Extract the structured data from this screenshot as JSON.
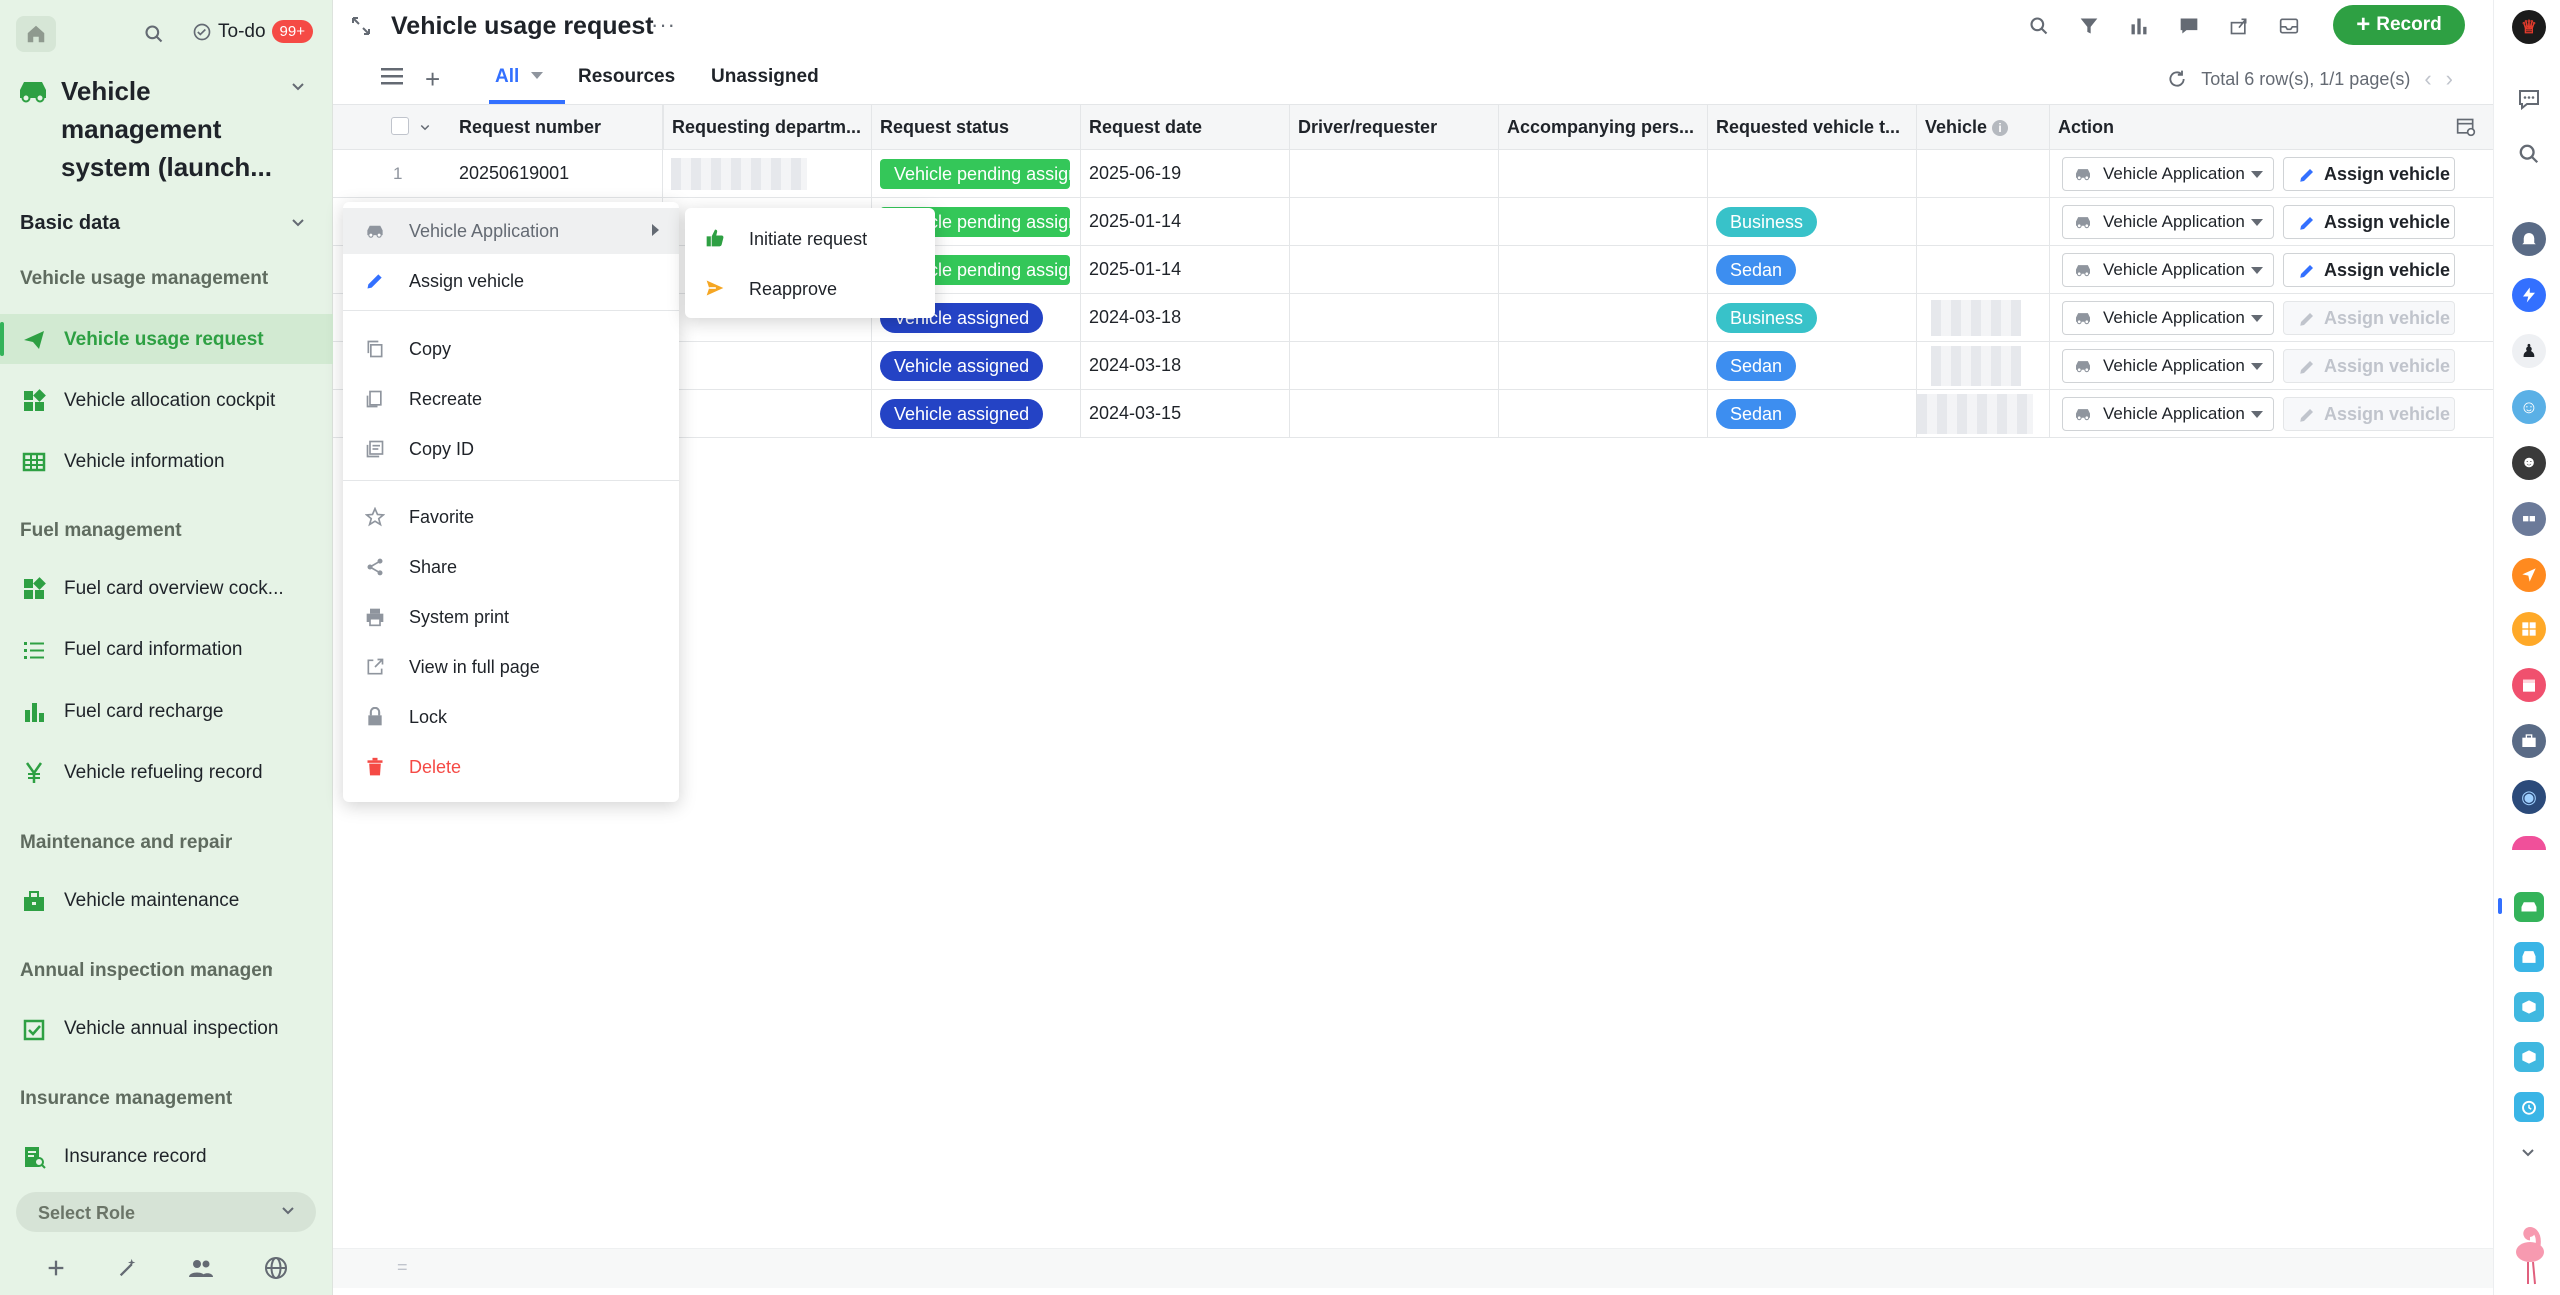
{
  "sidebar": {
    "todo_label": "To-do",
    "todo_badge": "99+",
    "app_title": "Vehicle management system (launch...",
    "basic_data": "Basic data",
    "sections": {
      "vehicle_usage": "Vehicle usage management",
      "fuel": "Fuel management",
      "maintenance": "Maintenance and repair",
      "annual": "Annual inspection management",
      "insurance": "Insurance management"
    },
    "items": {
      "vehicle_usage_request": "Vehicle usage request",
      "allocation_cockpit": "Vehicle allocation cockpit",
      "vehicle_information": "Vehicle information",
      "fuel_overview": "Fuel card overview cock...",
      "fuel_info": "Fuel card information",
      "fuel_recharge": "Fuel card recharge",
      "refueling_record": "Vehicle refueling record",
      "maintenance": "Vehicle maintenance",
      "annual_inspection": "Vehicle annual inspection",
      "insurance_record": "Insurance record"
    },
    "select_role": "Select Role"
  },
  "header": {
    "title": "Vehicle usage request",
    "record_button": "Record"
  },
  "tabs": {
    "all": "All",
    "resources": "Resources",
    "unassigned": "Unassigned"
  },
  "paging": "Total 6 row(s), 1/1 page(s)",
  "table": {
    "columns": [
      "Request number",
      "Requesting departm...",
      "Request status",
      "Request date",
      "Driver/requester",
      "Accompanying pers...",
      "Requested vehicle t...",
      "Vehicle",
      "Action"
    ],
    "rows": [
      {
        "num": "1",
        "request_number": "20250619001",
        "status": "Vehicle pending assignment",
        "date": "2025-06-19",
        "vehicle_type": "",
        "action": "Vehicle Application",
        "assign": "Assign vehicle"
      },
      {
        "num": "",
        "request_number": "",
        "status": "Vehicle pending assignment",
        "date": "2025-01-14",
        "vehicle_type": "Business",
        "action": "Vehicle Application",
        "assign": "Assign vehicle"
      },
      {
        "num": "",
        "request_number": "",
        "status": "Vehicle pending assignment",
        "date": "2025-01-14",
        "vehicle_type": "Sedan",
        "action": "Vehicle Application",
        "assign": "Assign vehicle"
      },
      {
        "num": "",
        "request_number": "",
        "status": "Vehicle assigned",
        "date": "2024-03-18",
        "vehicle_type": "Business",
        "action": "Vehicle Application",
        "assign": "Assign vehicle"
      },
      {
        "num": "",
        "request_number": "",
        "status": "Vehicle assigned",
        "date": "2024-03-18",
        "vehicle_type": "Sedan",
        "action": "Vehicle Application",
        "assign": "Assign vehicle"
      },
      {
        "num": "",
        "request_number": "",
        "status": "Vehicle assigned",
        "date": "2024-03-15",
        "vehicle_type": "Sedan",
        "action": "Vehicle Application",
        "assign": "Assign vehicle"
      }
    ]
  },
  "context_menu": {
    "vehicle_application": "Vehicle Application",
    "assign_vehicle": "Assign vehicle",
    "copy": "Copy",
    "recreate": "Recreate",
    "copy_id": "Copy ID",
    "favorite": "Favorite",
    "share": "Share",
    "system_print": "System print",
    "view_full_page": "View in full page",
    "lock": "Lock",
    "delete": "Delete"
  },
  "submenu": {
    "initiate_request": "Initiate request",
    "reapprove": "Reapprove"
  },
  "colors": {
    "brand_green": "#2ea043",
    "tab_blue": "#3370ff",
    "pending_green": "#34c759",
    "assigned_blue": "#2443c5",
    "business_teal": "#38c2c9",
    "sedan_blue": "#3d8ef0",
    "danger_red": "#f54a45"
  }
}
